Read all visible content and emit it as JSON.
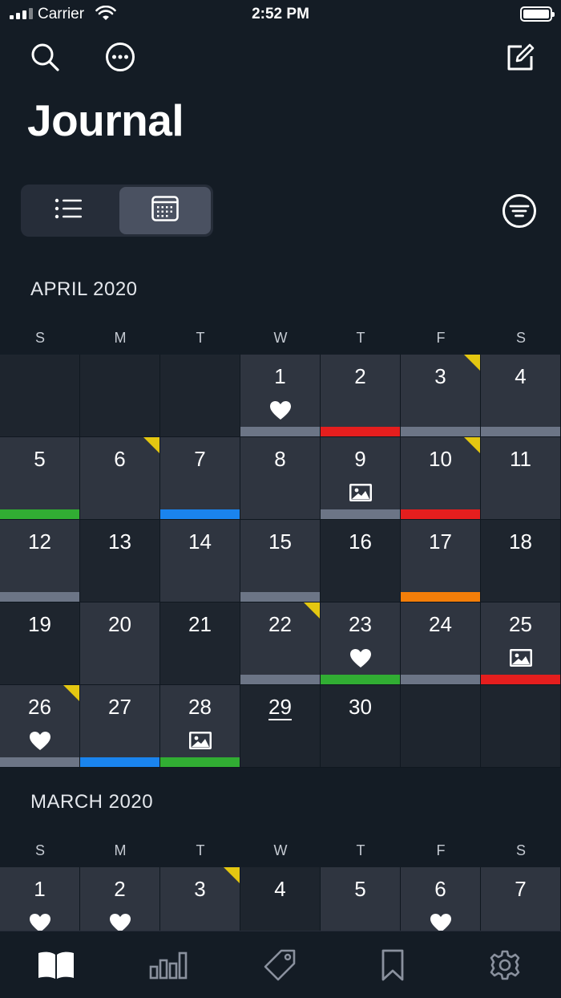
{
  "status_bar": {
    "carrier": "Carrier",
    "time": "2:52 PM"
  },
  "header": {
    "title": "Journal",
    "icons": [
      "search-icon",
      "more-icon",
      "compose-icon",
      "filter-icon"
    ]
  },
  "view_toggle": {
    "options": [
      "list-view",
      "calendar-view"
    ],
    "selected": "calendar-view"
  },
  "colors": {
    "gray": "#6c7586",
    "red": "#e51e1e",
    "green": "#31ad33",
    "blue": "#1a84ee",
    "orange": "#f47e09",
    "yellow": "#e4c711"
  },
  "calendar": {
    "weekdays": [
      "S",
      "M",
      "T",
      "W",
      "T",
      "F",
      "S"
    ],
    "april": {
      "label": "APRIL 2020",
      "lead_blanks": 3,
      "today": "29",
      "days": [
        {
          "d": "1",
          "fill": "l",
          "bar": "gray",
          "icon": "heart"
        },
        {
          "d": "2",
          "fill": "l",
          "bar": "red"
        },
        {
          "d": "3",
          "fill": "l",
          "bar": "gray",
          "flag": true
        },
        {
          "d": "4",
          "fill": "l",
          "bar": "gray"
        },
        {
          "d": "5",
          "fill": "l",
          "bar": "green"
        },
        {
          "d": "6",
          "fill": "l",
          "flag": true
        },
        {
          "d": "7",
          "fill": "l",
          "bar": "blue"
        },
        {
          "d": "8",
          "fill": "l"
        },
        {
          "d": "9",
          "fill": "l",
          "bar": "gray",
          "icon": "photo"
        },
        {
          "d": "10",
          "fill": "l",
          "bar": "red",
          "flag": true
        },
        {
          "d": "11",
          "fill": "l"
        },
        {
          "d": "12",
          "fill": "l",
          "bar": "gray"
        },
        {
          "d": "13",
          "fill": "d"
        },
        {
          "d": "14",
          "fill": "l"
        },
        {
          "d": "15",
          "fill": "l",
          "bar": "gray"
        },
        {
          "d": "16",
          "fill": "d"
        },
        {
          "d": "17",
          "fill": "l",
          "bar": "orange"
        },
        {
          "d": "18",
          "fill": "d"
        },
        {
          "d": "19",
          "fill": "d"
        },
        {
          "d": "20",
          "fill": "l"
        },
        {
          "d": "21",
          "fill": "d"
        },
        {
          "d": "22",
          "fill": "l",
          "bar": "gray",
          "flag": true
        },
        {
          "d": "23",
          "fill": "l",
          "bar": "green",
          "icon": "heart"
        },
        {
          "d": "24",
          "fill": "l",
          "bar": "gray"
        },
        {
          "d": "25",
          "fill": "l",
          "bar": "red",
          "icon": "photo"
        },
        {
          "d": "26",
          "fill": "l",
          "bar": "gray",
          "flag": true,
          "icon": "heart"
        },
        {
          "d": "27",
          "fill": "l",
          "bar": "blue"
        },
        {
          "d": "28",
          "fill": "l",
          "bar": "green",
          "icon": "photo"
        },
        {
          "d": "29",
          "fill": "d"
        },
        {
          "d": "30",
          "fill": "d"
        }
      ],
      "trail_blanks": 2
    },
    "march": {
      "label": "MARCH 2020",
      "days": [
        {
          "d": "1",
          "fill": "l",
          "icon": "heart"
        },
        {
          "d": "2",
          "fill": "l",
          "icon": "heart"
        },
        {
          "d": "3",
          "fill": "l",
          "flag": true
        },
        {
          "d": "4",
          "fill": "d"
        },
        {
          "d": "5",
          "fill": "l"
        },
        {
          "d": "6",
          "fill": "l",
          "icon": "heart"
        },
        {
          "d": "7",
          "fill": "l"
        }
      ]
    }
  },
  "tab_bar": {
    "items": [
      "journal-icon",
      "stats-icon",
      "tags-icon",
      "bookmark-icon",
      "settings-icon"
    ],
    "selected": "journal-icon"
  }
}
